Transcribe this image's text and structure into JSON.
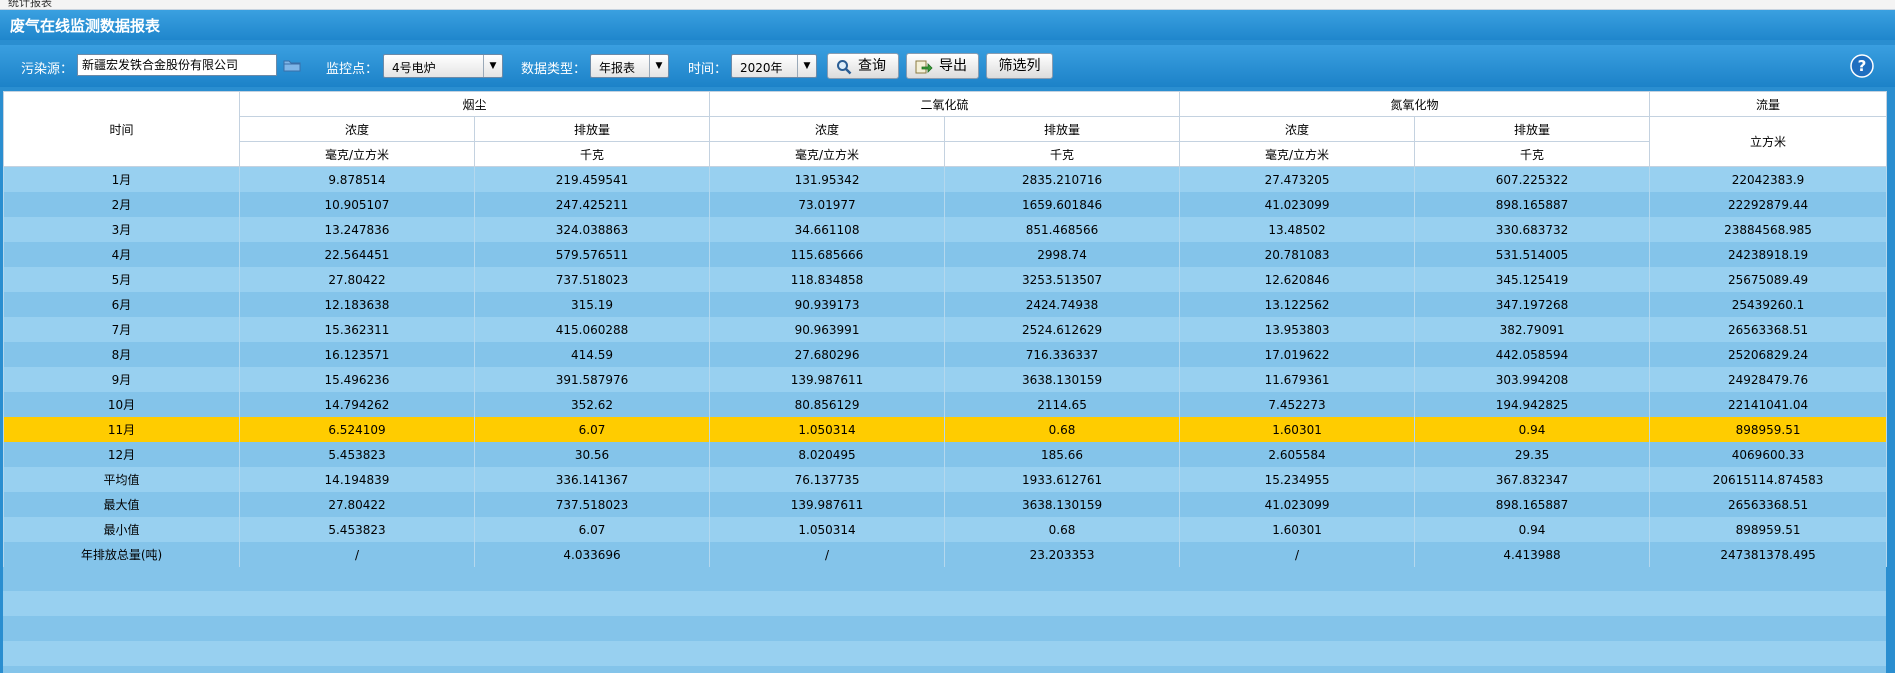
{
  "window": {
    "tab_label": "统计报表"
  },
  "panel": {
    "title": "废气在线监测数据报表"
  },
  "toolbar": {
    "source_label": "污染源：",
    "source_value": "新疆宏发铁合金股份有限公司",
    "point_label": "监控点：",
    "point_value": "4号电炉",
    "type_label": "数据类型：",
    "type_value": "年报表",
    "time_label": "时间：",
    "time_value": "2020年",
    "query_label": "查询",
    "export_label": "导出",
    "filter_label": "筛选列"
  },
  "colors": {
    "highlight": "#ffcc00",
    "row_light": "#98d0f0",
    "row_dark": "#84c4ea",
    "title_bar": "#2a8ed0"
  },
  "icons": [
    "folder-icon",
    "search-icon",
    "export-icon",
    "help-icon"
  ],
  "table": {
    "time_header": "时间",
    "groups": [
      "烟尘",
      "二氧化硫",
      "氮氧化物",
      "流量"
    ],
    "sub_headers": [
      "浓度",
      "排放量",
      "浓度",
      "排放量",
      "浓度",
      "排放量"
    ],
    "units": [
      "毫克/立方米",
      "千克",
      "毫克/立方米",
      "千克",
      "毫克/立方米",
      "千克"
    ],
    "flow_unit": "立方米",
    "highlight_row": 10,
    "rows": [
      [
        "1月",
        "9.878514",
        "219.459541",
        "131.95342",
        "2835.210716",
        "27.473205",
        "607.225322",
        "22042383.9"
      ],
      [
        "2月",
        "10.905107",
        "247.425211",
        "73.01977",
        "1659.601846",
        "41.023099",
        "898.165887",
        "22292879.44"
      ],
      [
        "3月",
        "13.247836",
        "324.038863",
        "34.661108",
        "851.468566",
        "13.48502",
        "330.683732",
        "23884568.985"
      ],
      [
        "4月",
        "22.564451",
        "579.576511",
        "115.685666",
        "2998.74",
        "20.781083",
        "531.514005",
        "24238918.19"
      ],
      [
        "5月",
        "27.80422",
        "737.518023",
        "118.834858",
        "3253.513507",
        "12.620846",
        "345.125419",
        "25675089.49"
      ],
      [
        "6月",
        "12.183638",
        "315.19",
        "90.939173",
        "2424.74938",
        "13.122562",
        "347.197268",
        "25439260.1"
      ],
      [
        "7月",
        "15.362311",
        "415.060288",
        "90.963991",
        "2524.612629",
        "13.953803",
        "382.79091",
        "26563368.51"
      ],
      [
        "8月",
        "16.123571",
        "414.59",
        "27.680296",
        "716.336337",
        "17.019622",
        "442.058594",
        "25206829.24"
      ],
      [
        "9月",
        "15.496236",
        "391.587976",
        "139.987611",
        "3638.130159",
        "11.679361",
        "303.994208",
        "24928479.76"
      ],
      [
        "10月",
        "14.794262",
        "352.62",
        "80.856129",
        "2114.65",
        "7.452273",
        "194.942825",
        "22141041.04"
      ],
      [
        "11月",
        "6.524109",
        "6.07",
        "1.050314",
        "0.68",
        "1.60301",
        "0.94",
        "898959.51"
      ],
      [
        "12月",
        "5.453823",
        "30.56",
        "8.020495",
        "185.66",
        "2.605584",
        "29.35",
        "4069600.33"
      ],
      [
        "平均值",
        "14.194839",
        "336.141367",
        "76.137735",
        "1933.612761",
        "15.234955",
        "367.832347",
        "20615114.874583"
      ],
      [
        "最大值",
        "27.80422",
        "737.518023",
        "139.987611",
        "3638.130159",
        "41.023099",
        "898.165887",
        "26563368.51"
      ],
      [
        "最小值",
        "5.453823",
        "6.07",
        "1.050314",
        "0.68",
        "1.60301",
        "0.94",
        "898959.51"
      ],
      [
        "年排放总量(吨)",
        "/",
        "4.033696",
        "/",
        "23.203353",
        "/",
        "4.413988",
        "247381378.495"
      ]
    ]
  }
}
